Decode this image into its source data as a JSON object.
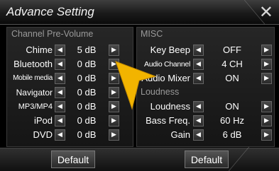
{
  "header": {
    "title": "Advance Setting",
    "close_icon": "close-icon"
  },
  "left": {
    "section_title": "Channel Pre-Volume",
    "rows": [
      {
        "label": "Chime",
        "value": "5 dB"
      },
      {
        "label": "Bluetooth",
        "value": "0 dB"
      },
      {
        "label": "Mobile media",
        "value": "0 dB"
      },
      {
        "label": "Navigator",
        "value": "0 dB"
      },
      {
        "label": "MP3/MP4",
        "value": "0 dB"
      },
      {
        "label": "iPod",
        "value": "0 dB"
      },
      {
        "label": "DVD",
        "value": "0 dB"
      }
    ],
    "default_label": "Default"
  },
  "right": {
    "misc_title": "MISC",
    "misc_rows": [
      {
        "label": "Key Beep",
        "value": "OFF"
      },
      {
        "label": "Audio Channel",
        "value": "4 CH"
      },
      {
        "label": "Audio Mixer",
        "value": "ON"
      }
    ],
    "loudness_title": "Loudness",
    "loudness_rows": [
      {
        "label": "Loudness",
        "value": "ON"
      },
      {
        "label": "Bass Freq.",
        "value": "60 Hz"
      },
      {
        "label": "Gain",
        "value": "6 dB"
      }
    ],
    "default_label": "Default"
  },
  "icons": {
    "left_arrow": "◀",
    "right_arrow": "▶",
    "close": "✕"
  },
  "colors": {
    "pointer": "#f2b400"
  }
}
